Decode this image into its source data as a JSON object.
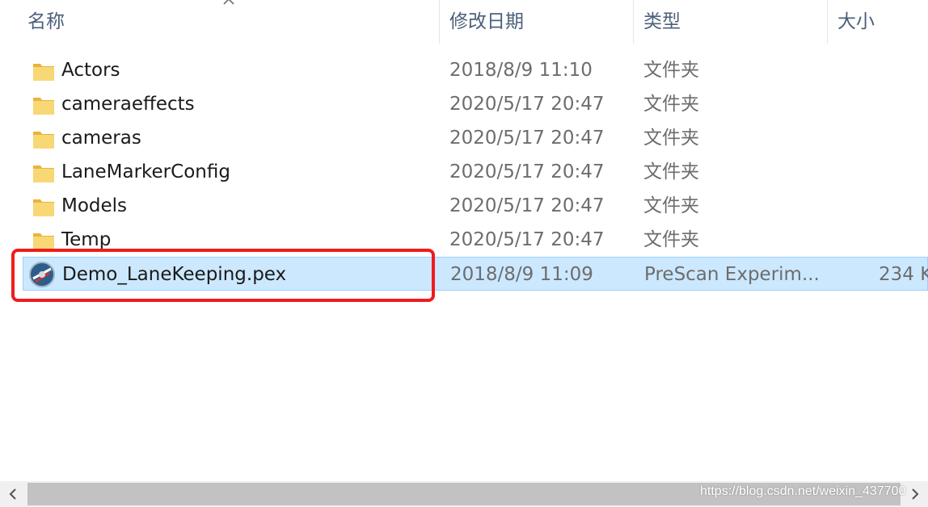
{
  "columns": {
    "name": "名称",
    "date": "修改日期",
    "type": "类型",
    "size": "大小"
  },
  "sort_icon": "chevron-up-icon",
  "files": [
    {
      "name": "Actors",
      "date": "2018/8/9 11:10",
      "type": "文件夹",
      "size": "",
      "icon": "folder-icon"
    },
    {
      "name": "cameraeffects",
      "date": "2020/5/17 20:47",
      "type": "文件夹",
      "size": "",
      "icon": "folder-icon"
    },
    {
      "name": "cameras",
      "date": "2020/5/17 20:47",
      "type": "文件夹",
      "size": "",
      "icon": "folder-icon"
    },
    {
      "name": "LaneMarkerConfig",
      "date": "2020/5/17 20:47",
      "type": "文件夹",
      "size": "",
      "icon": "folder-icon"
    },
    {
      "name": "Models",
      "date": "2020/5/17 20:47",
      "type": "文件夹",
      "size": "",
      "icon": "folder-icon"
    },
    {
      "name": "Temp",
      "date": "2020/5/17 20:47",
      "type": "文件夹",
      "size": "",
      "icon": "folder-icon"
    },
    {
      "name": "Demo_LaneKeeping.pex",
      "date": "2018/8/9 11:09",
      "type": "PreScan Experim...",
      "size": "234 K",
      "icon": "prescan-app-icon",
      "selected": true
    }
  ],
  "watermark": "https://blog.csdn.net/weixin_437700",
  "colors": {
    "selection_bg": "#cce8ff",
    "selection_border": "#99d1ff",
    "highlight_box": "#f01c1c",
    "folder": "#f5c84c"
  }
}
